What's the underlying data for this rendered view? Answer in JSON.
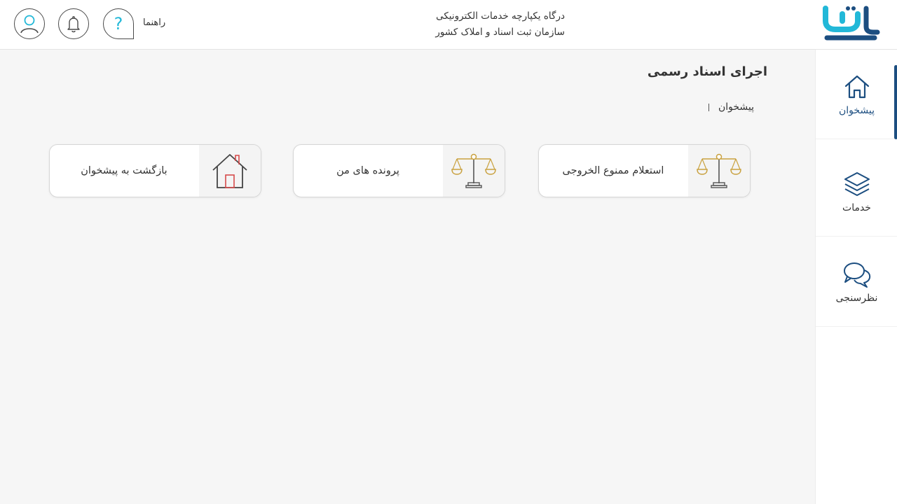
{
  "header": {
    "line1": "درگاه یکپارچه خدمات الکترونیکی",
    "line2": "سازمان ثبت اسناد و املاک کشور",
    "help_label": "راهنما",
    "help_glyph": "?",
    "icons": [
      "user-icon",
      "bell-icon",
      "help-icon"
    ]
  },
  "sidebar": {
    "items": [
      {
        "label": "پیشخوان",
        "icon": "home-icon",
        "active": true
      },
      {
        "label": "خدمات",
        "icon": "layers-icon",
        "active": false
      },
      {
        "label": "نظرسنجی",
        "icon": "chat-icon",
        "active": false
      }
    ]
  },
  "main": {
    "title": "اجرای اسناد رسمی",
    "breadcrumb": "پیشخوان",
    "cards": [
      {
        "label": "استعلام ممنوع الخروجی",
        "icon": "scales-icon"
      },
      {
        "label": "پرونده های من",
        "icon": "scales-icon"
      },
      {
        "label": "بازگشت به پیشخوان",
        "icon": "house-icon"
      }
    ]
  },
  "colors": {
    "accent": "#1c4e80",
    "logo_cyan": "#22b8d8",
    "scales_gold": "#c9a13f",
    "house_red": "#d64a4a",
    "background": "#f6f6f6"
  }
}
